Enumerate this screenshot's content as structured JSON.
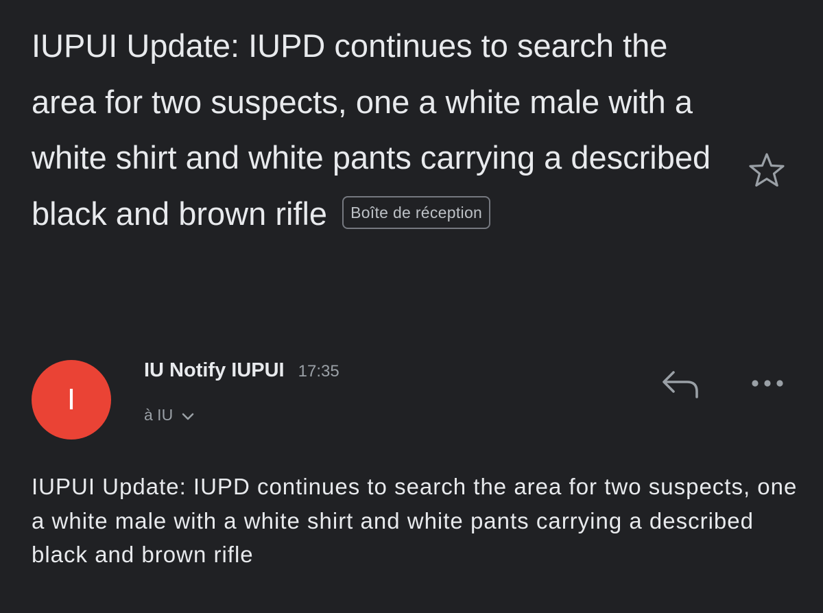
{
  "email": {
    "subject": "IUPUI Update: IUPD continues to search the area for two suspects, one a white male with a white shirt and white pants carrying a described black and brown rifle",
    "label": "Boîte de réception",
    "starred": false,
    "sender": {
      "avatar_initial": "I",
      "avatar_color": "#ea4335",
      "name": "IU Notify IUPUI",
      "time": "17:35",
      "recipient": "à IU"
    },
    "body": "IUPUI Update: IUPD continues to search the area for two suspects, one a white male with a white shirt and white pants carrying a described black and brown rifle"
  },
  "icons": {
    "star": "star-outline-icon",
    "reply": "reply-icon",
    "more": "more-horizontal-icon",
    "expand": "chevron-down-icon"
  },
  "colors": {
    "background": "#202124",
    "text_primary": "#e8eaed",
    "text_secondary": "#9aa0a6"
  }
}
